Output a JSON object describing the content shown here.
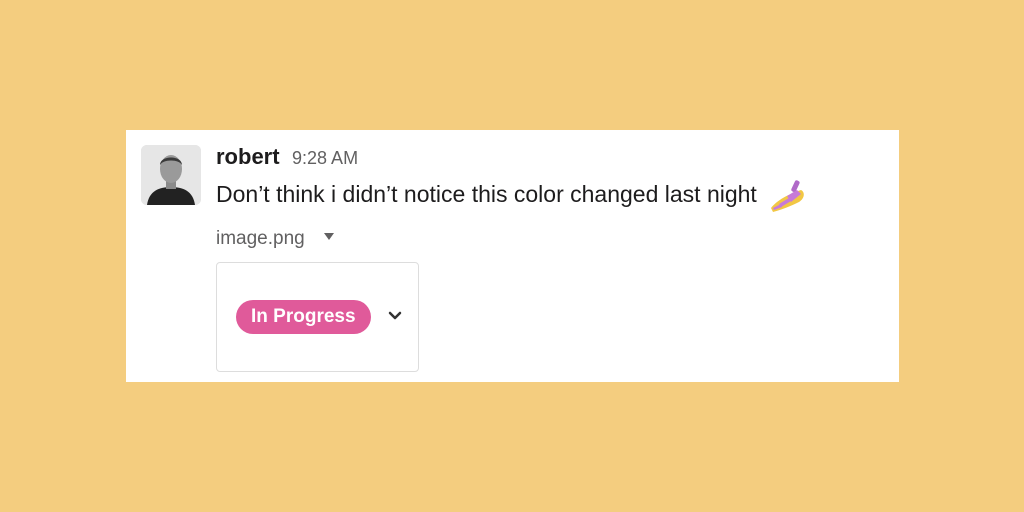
{
  "message": {
    "author": "robert",
    "time": "9:28 AM",
    "text": "Don’t think i didn’t notice this color changed last night",
    "emoji": "nail-polish-icon",
    "attachment": {
      "filename": "image.png",
      "preview": {
        "status_label": "In Progress",
        "status_color": "#E05A9A"
      }
    }
  },
  "colors": {
    "background": "#F4CD7F",
    "card": "#FFFFFF"
  }
}
